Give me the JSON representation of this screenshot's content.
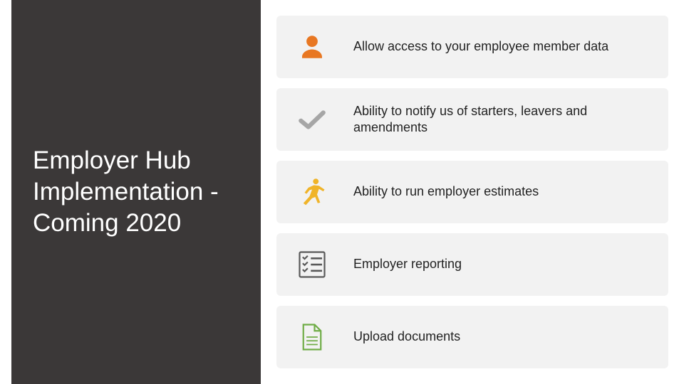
{
  "title": "Employer Hub Implementation - Coming 2020",
  "features": [
    {
      "icon": "person-icon",
      "color": "#E87722",
      "text": "Allow access to your employee member data"
    },
    {
      "icon": "check-icon",
      "color": "#A6A6A6",
      "text": "Ability to notify us of starters, leavers and amendments"
    },
    {
      "icon": "runner-icon",
      "color": "#F0B429",
      "text": "Ability to run employer estimates"
    },
    {
      "icon": "checklist-icon",
      "color": "#595959",
      "text": "Employer reporting"
    },
    {
      "icon": "document-icon",
      "color": "#70AD47",
      "text": "Upload documents"
    }
  ]
}
